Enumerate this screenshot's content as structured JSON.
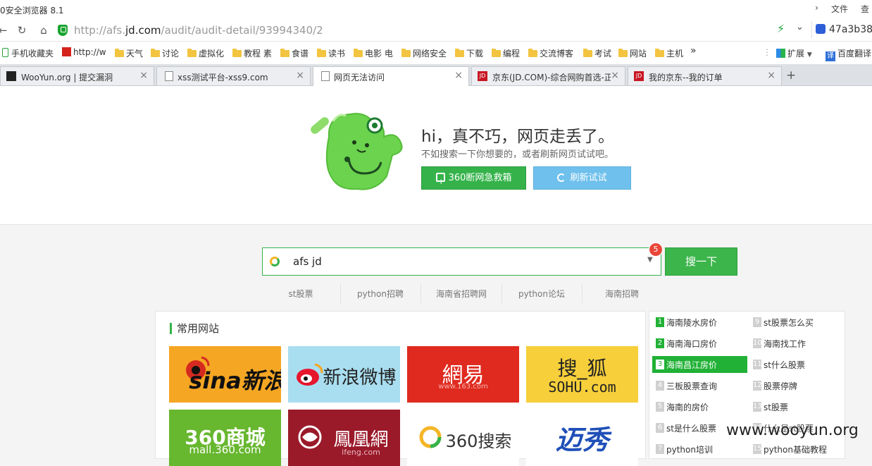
{
  "window": {
    "title": "0安全浏览器 8.1",
    "menu": [
      "文件",
      "查"
    ]
  },
  "addressbar": {
    "url_prefix": "http://afs.",
    "url_domain": "jd.com",
    "url_path": "/audit/audit-detail/93994340/2",
    "extension_text": "47a3b38"
  },
  "bookmarks": [
    {
      "label": "手机收藏夹",
      "icon": "phone-icon"
    },
    {
      "label": "http://w",
      "icon": "site-icon"
    },
    {
      "label": "天气",
      "icon": "folder-icon"
    },
    {
      "label": "讨论",
      "icon": "folder-icon"
    },
    {
      "label": "虚拟化",
      "icon": "folder-icon"
    },
    {
      "label": "教程 素",
      "icon": "folder-icon"
    },
    {
      "label": "食谱",
      "icon": "folder-icon"
    },
    {
      "label": "读书",
      "icon": "folder-icon"
    },
    {
      "label": "电影 电",
      "icon": "folder-icon"
    },
    {
      "label": "网络安全",
      "icon": "folder-icon"
    },
    {
      "label": "下载",
      "icon": "folder-icon"
    },
    {
      "label": "编程",
      "icon": "folder-icon"
    },
    {
      "label": "交流博客",
      "icon": "folder-icon"
    },
    {
      "label": "考试",
      "icon": "folder-icon"
    },
    {
      "label": "网站",
      "icon": "folder-icon"
    },
    {
      "label": "主机",
      "icon": "folder-icon"
    }
  ],
  "bookmarks_more": "»",
  "bookmarks_right": {
    "extensions": "扩展",
    "translate": "百度翻译"
  },
  "tabs": [
    {
      "label": "WooYun.org | 提交漏洞",
      "icon": "wooyun-icon",
      "active": false
    },
    {
      "label": "xss测试平台-xss9.com",
      "icon": "page-icon",
      "active": false
    },
    {
      "label": "网页无法访问",
      "icon": "page-icon",
      "active": true
    },
    {
      "label": "京东(JD.COM)-综合网购首选-正",
      "icon": "jd-icon",
      "active": false
    },
    {
      "label": "我的京东--我的订单",
      "icon": "jd-icon",
      "active": false
    }
  ],
  "error": {
    "title": "hi，真不巧，网页走丢了。",
    "subtitle": "不如搜索一下你想要的，或者刷新网页试试吧。",
    "rescue_button": "360断网急救箱",
    "refresh_button": "刷新试试"
  },
  "search": {
    "value": "afs jd",
    "badge": "5",
    "button": "搜一下",
    "suggestions": [
      "st股票",
      "python招聘",
      "海南省招聘网",
      "python论坛",
      "海南招聘"
    ]
  },
  "sites": {
    "title": "常用网站",
    "tiles": [
      {
        "name": "新浪",
        "text": "sina新浪",
        "bg": "#f5a623",
        "fg": "#111"
      },
      {
        "name": "新浪微博",
        "text": "新浪微博",
        "bg": "#a9def0",
        "fg": "#222"
      },
      {
        "name": "网易",
        "text": "網易",
        "sub": "www.163.com",
        "bg": "#e02a1f",
        "fg": "#fff"
      },
      {
        "name": "搜狐",
        "text": "搜_狐",
        "sub": "SOHU.com",
        "bg": "#f6cf3a",
        "fg": "#222"
      },
      {
        "name": "360商城",
        "text": "360商城",
        "sub": "mall.360.com",
        "bg": "#67b72f",
        "fg": "#fff"
      },
      {
        "name": "凤凰网",
        "text": "鳳凰網",
        "sub": "ifeng.com",
        "bg": "#9a1a2a",
        "fg": "#fff"
      },
      {
        "name": "360搜索",
        "text": "360搜索",
        "bg": "#ffffff",
        "fg": "#333"
      },
      {
        "name": "迅秀",
        "text": "迈秀",
        "bg": "#ffffff",
        "fg": "#1f4fb8"
      }
    ]
  },
  "hot": {
    "items": [
      {
        "num": "1",
        "text": "海南陵水房价"
      },
      {
        "num": "2",
        "text": "海南海口房价"
      },
      {
        "num": "3",
        "text": "海南昌江房价",
        "selected": true
      },
      {
        "num": "4",
        "text": "三板股票查询"
      },
      {
        "num": "5",
        "text": "海南的房价"
      },
      {
        "num": "6",
        "text": "st是什么股票"
      },
      {
        "num": "7",
        "text": "python培训"
      },
      {
        "num": "9",
        "text": "st股票怎么买"
      },
      {
        "num": "10",
        "text": "海南找工作"
      },
      {
        "num": "11",
        "text": "st什么股票"
      },
      {
        "num": "12",
        "text": "股票停牌"
      },
      {
        "num": "13",
        "text": "st股票"
      },
      {
        "num": "14",
        "text": "什么是st股票"
      },
      {
        "num": "15",
        "text": "python基础教程"
      }
    ]
  },
  "watermark": "www.wooyun.org"
}
